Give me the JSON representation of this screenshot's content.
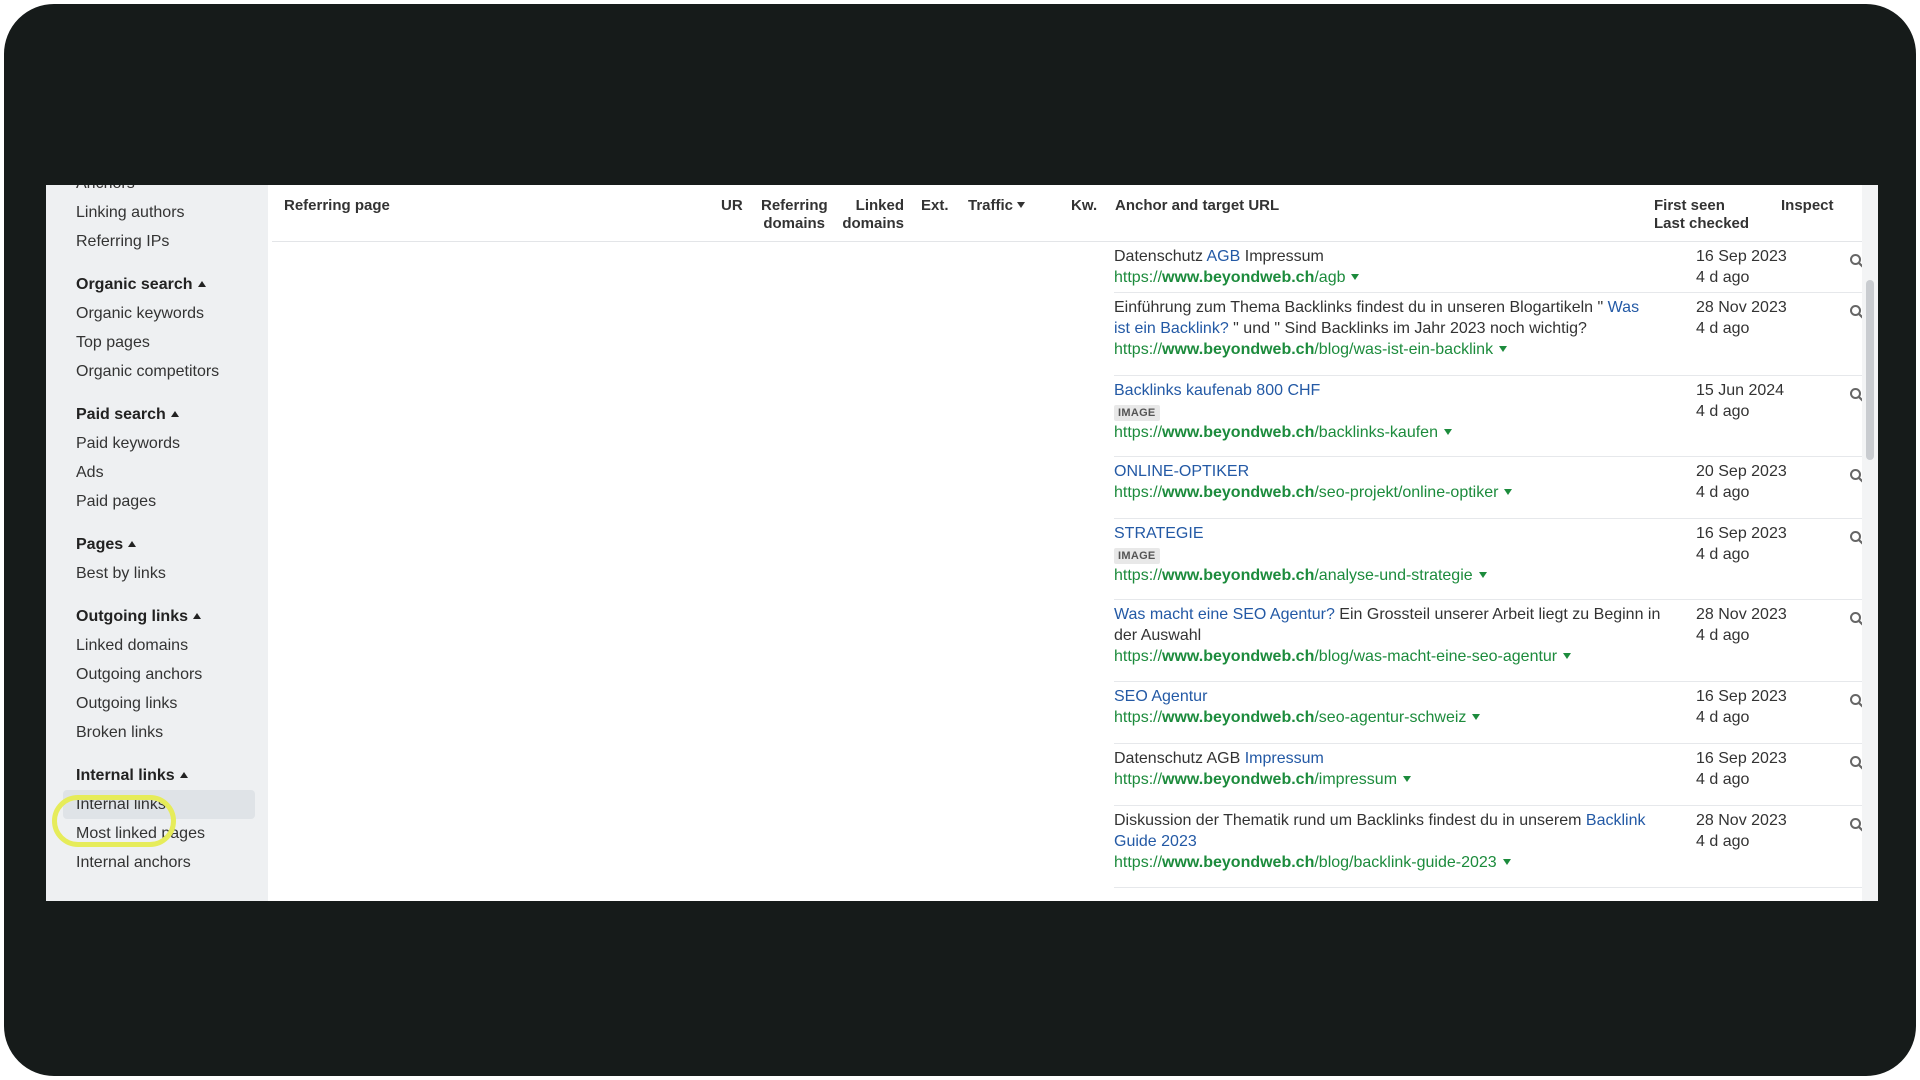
{
  "sidebar": {
    "groups": [
      {
        "items": [
          "Anchors",
          "Linking authors",
          "Referring IPs"
        ]
      },
      {
        "heading": "Organic search",
        "items": [
          "Organic keywords",
          "Top pages",
          "Organic competitors"
        ]
      },
      {
        "heading": "Paid search",
        "items": [
          "Paid keywords",
          "Ads",
          "Paid pages"
        ]
      },
      {
        "heading": "Pages",
        "items": [
          "Best by links"
        ]
      },
      {
        "heading": "Outgoing links",
        "items": [
          "Linked domains",
          "Outgoing anchors",
          "Outgoing links",
          "Broken links"
        ]
      },
      {
        "heading": "Internal links",
        "items": [
          "Internal links",
          "Most linked pages",
          "Internal anchors"
        ]
      }
    ],
    "active_item": "Internal links"
  },
  "table": {
    "headers": {
      "referring_page": "Referring page",
      "ur": "UR",
      "referring_domains_1": "Referring",
      "referring_domains_2": "domains",
      "linked_domains_1": "Linked",
      "linked_domains_2": "domains",
      "ext": "Ext.",
      "traffic": "Traffic",
      "kw": "Kw.",
      "anchor_target": "Anchor and target URL",
      "first_seen": "First seen",
      "last_checked": "Last checked",
      "inspect": "Inspect"
    },
    "rows": [
      {
        "pre": "Datenschutz ",
        "link": "AGB",
        "post": " Impressum",
        "badge": "",
        "url_prefix": "https://",
        "url_domain": "www.beyondweb.ch",
        "url_path": "/agb",
        "first_seen": "16 Sep 2023",
        "last_checked": "4 d ago"
      },
      {
        "pre": "Einführung zum Thema Backlinks findest du in unseren Blogartikeln \" ",
        "link": "Was ist ein Backlink?",
        "post": " \" und \" Sind Backlinks im Jahr 2023 noch wichtig?",
        "badge": "",
        "url_prefix": "https://",
        "url_domain": "www.beyondweb.ch",
        "url_path": "/blog/was-ist-ein-backlink",
        "first_seen": "28 Nov 2023",
        "last_checked": "4 d ago"
      },
      {
        "pre": "",
        "link": "Backlinks kaufenab 800 CHF",
        "post": "",
        "badge": "IMAGE",
        "url_prefix": "https://",
        "url_domain": "www.beyondweb.ch",
        "url_path": "/backlinks-kaufen",
        "first_seen": "15 Jun 2024",
        "last_checked": "4 d ago"
      },
      {
        "pre": "",
        "link": "ONLINE-OPTIKER",
        "post": "",
        "badge": "",
        "url_prefix": "https://",
        "url_domain": "www.beyondweb.ch",
        "url_path": "/seo-projekt/online-optiker",
        "first_seen": "20 Sep 2023",
        "last_checked": "4 d ago"
      },
      {
        "pre": "",
        "link": "STRATEGIE",
        "post": "",
        "badge": "IMAGE",
        "url_prefix": "https://",
        "url_domain": "www.beyondweb.ch",
        "url_path": "/analyse-und-strategie",
        "first_seen": "16 Sep 2023",
        "last_checked": "4 d ago"
      },
      {
        "pre": "",
        "link": "Was macht eine SEO Agentur?",
        "post": " Ein Grossteil unserer Arbeit liegt zu Beginn in der Auswahl",
        "badge": "",
        "url_prefix": "https://",
        "url_domain": "www.beyondweb.ch",
        "url_path": "/blog/was-macht-eine-seo-agentur",
        "first_seen": "28 Nov 2023",
        "last_checked": "4 d ago"
      },
      {
        "pre": "",
        "link": "SEO Agentur",
        "post": "",
        "badge": "",
        "url_prefix": "https://",
        "url_domain": "www.beyondweb.ch",
        "url_path": "/seo-agentur-schweiz",
        "first_seen": "16 Sep 2023",
        "last_checked": "4 d ago"
      },
      {
        "pre": "Datenschutz AGB ",
        "link": "Impressum",
        "post": "",
        "badge": "",
        "url_prefix": "https://",
        "url_domain": "www.beyondweb.ch",
        "url_path": "/impressum",
        "first_seen": "16 Sep 2023",
        "last_checked": "4 d ago"
      },
      {
        "pre": "Diskussion der Thematik rund um Backlinks findest du in unserem ",
        "link": "Backlink Guide 2023",
        "post": "",
        "badge": "",
        "url_prefix": "https://",
        "url_domain": "www.beyondweb.ch",
        "url_path": "/blog/backlink-guide-2023",
        "first_seen": "28 Nov 2023",
        "last_checked": "4 d ago"
      }
    ]
  },
  "colors": {
    "link_blue": "#2359a5",
    "url_green": "#1c8b3c",
    "highlight_ring": "#e6ec5a",
    "frame_bg": "#161b1a"
  },
  "icons": {
    "inspect": "magnifier-icon",
    "sort": "caret-down-icon",
    "section_toggle": "caret-up-icon"
  }
}
